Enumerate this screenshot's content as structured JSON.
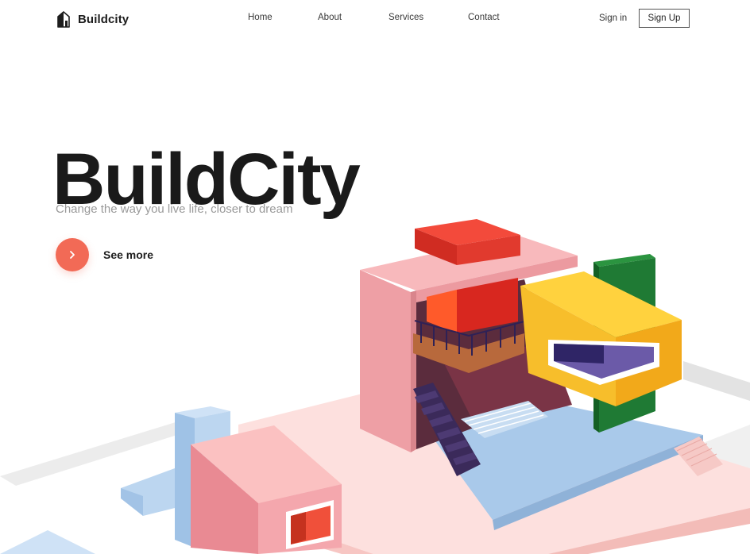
{
  "brand": {
    "name": "Buildcity",
    "logo_icon": "house-logo-icon"
  },
  "nav": {
    "links": [
      "Home",
      "About",
      "Services",
      "Contact"
    ],
    "sign_in": "Sign in",
    "sign_up": "Sign Up"
  },
  "hero": {
    "title": "BuildCity",
    "subtitle": "Change the way you live life, closer to dream",
    "cta_label": "See more",
    "cta_icon": "chevron-right-icon"
  },
  "illustration": {
    "name": "isometric-house-illustration",
    "colors": {
      "pink": "#f4a9ae",
      "red": "#e2342a",
      "yellow": "#f7be2b",
      "green": "#1f7a34",
      "blue": "#a9c9ea",
      "dark": "#3b2440"
    }
  },
  "theme": {
    "accent": "#f26a56"
  }
}
